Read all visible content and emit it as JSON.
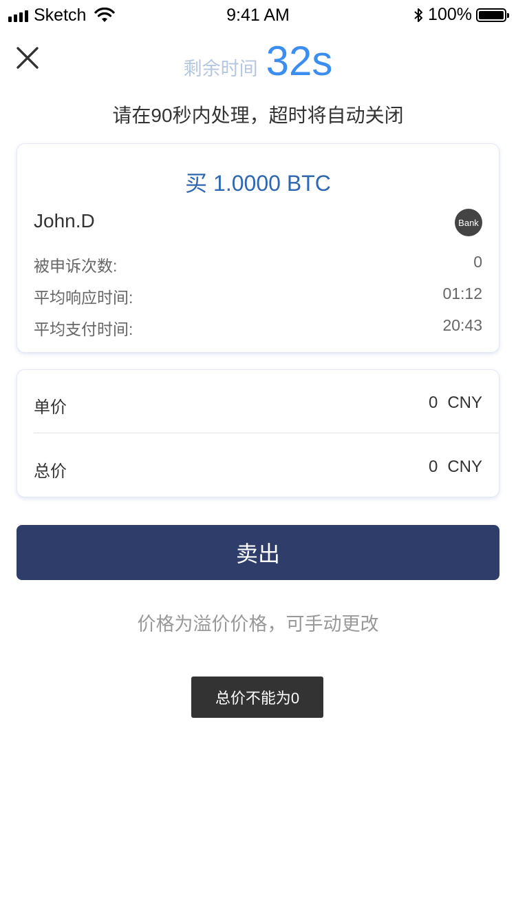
{
  "status_bar": {
    "carrier": "Sketch",
    "time": "9:41 AM",
    "battery": "100%"
  },
  "header": {
    "close_icon": "close-icon",
    "timer_label": "剩余时间",
    "timer_value": "32s",
    "subtitle": "请在90秒内处理，超时将自动关闭"
  },
  "order": {
    "title": "买 1.0000 BTC",
    "trader_name": "John.D",
    "payment_badge": "Bank",
    "stats": [
      {
        "label": "被申诉次数:",
        "value": "0"
      },
      {
        "label": "平均响应时间:",
        "value": "01:12"
      },
      {
        "label": "平均支付时间:",
        "value": "20:43"
      }
    ]
  },
  "price": {
    "unit_price": {
      "label": "单价",
      "amount": "0",
      "currency": "CNY"
    },
    "total_price": {
      "label": "总价",
      "amount": "0",
      "currency": "CNY"
    }
  },
  "actions": {
    "sell_label": "卖出"
  },
  "hint": "价格为溢价价格，可手动更改",
  "toast": "总价不能为0",
  "colors": {
    "accent": "#3b8ef0",
    "title_blue": "#2f67b1",
    "button_bg": "#2e3d69",
    "toast_bg": "#333333"
  }
}
